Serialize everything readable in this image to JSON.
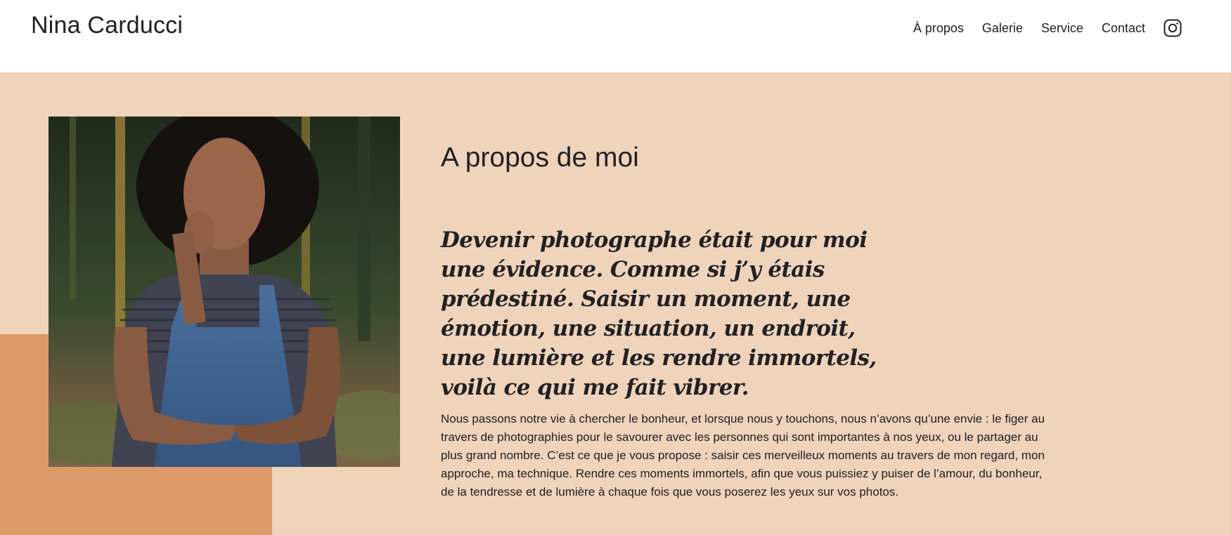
{
  "header": {
    "brand": "Nina Carducci",
    "nav": [
      {
        "label": "À propos"
      },
      {
        "label": "Galerie"
      },
      {
        "label": "Service"
      },
      {
        "label": "Contact"
      }
    ],
    "social_icon": "instagram-icon"
  },
  "about": {
    "title": "A propos de moi",
    "quote": "Devenir photographe était pour moi une évidence. Comme si j’y étais prédestiné. Saisir un moment, une émotion, une situation, un endroit, une lumière et les rendre immortels, voilà ce qui me fait vibrer.",
    "body": "Nous passons notre vie à chercher le bonheur, et lorsque nous y touchons, nous n’avons qu’une envie : le figer au travers de photographies pour le savourer avec les personnes qui sont importantes à nos yeux, ou le partager au plus grand nombre. C’est ce que je vous propose : saisir ces merveilleux moments au travers de mon regard, mon approche, ma technique. Rendre ces moments immortels, afin que vous puissiez y puiser de l’amour, du bonheur, de la tendresse et de lumière à chaque fois que vous poserez les yeux sur vos photos."
  },
  "colors": {
    "section_bg": "#efd3bb",
    "accent": "#dd9a69",
    "text": "#202124"
  }
}
